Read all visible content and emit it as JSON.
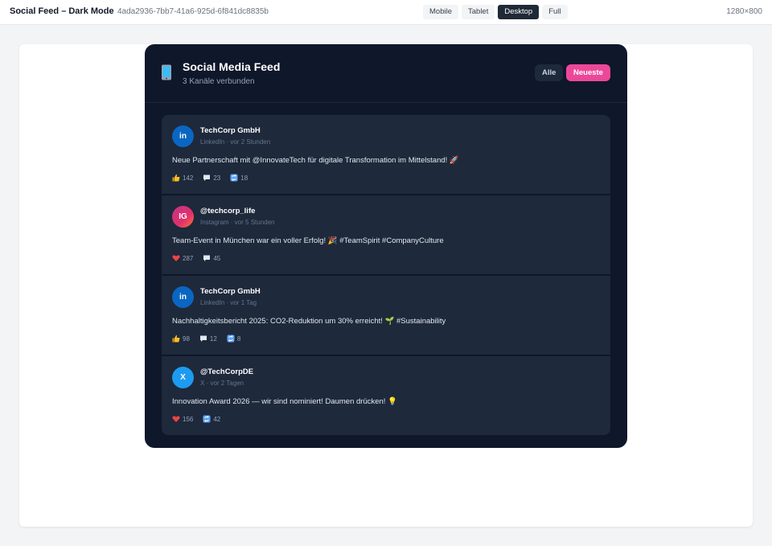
{
  "app": {
    "title": "Social Feed – Dark Mode",
    "id": "4ada2936-7bb7-41a6-925d-6f841dc8835b",
    "dimensions": "1280×800"
  },
  "viewport_tabs": [
    "Mobile",
    "Tablet",
    "Desktop",
    "Full"
  ],
  "active_viewport": "Desktop",
  "feed": {
    "title": "Social Media Feed",
    "subtitle": "3 Kanäle verbunden",
    "filters": {
      "all": "Alle",
      "newest": "Neueste"
    },
    "posts": [
      {
        "avatar": "in",
        "author": "TechCorp GmbH",
        "meta": "LinkedIn · vor 2 Stunden",
        "text": "Neue Partnerschaft mit @InnovateTech für digitale Transformation im Mittelstand! 🚀",
        "stats": [
          {
            "icon": "thumbs-up-icon",
            "value": "142"
          },
          {
            "icon": "comment-icon",
            "value": "23"
          },
          {
            "icon": "repost-icon",
            "value": "18"
          }
        ]
      },
      {
        "avatar": "IG",
        "author": "@techcorp_life",
        "meta": "Instagram · vor 5 Stunden",
        "text": "Team-Event in München war ein voller Erfolg! 🎉 #TeamSpirit #CompanyCulture",
        "stats": [
          {
            "icon": "heart-icon",
            "value": "287"
          },
          {
            "icon": "comment-icon",
            "value": "45"
          }
        ]
      },
      {
        "avatar": "in",
        "author": "TechCorp GmbH",
        "meta": "LinkedIn · vor 1 Tag",
        "text": "Nachhaltigkeitsbericht 2025: CO2-Reduktion um 30% erreicht! 🌱 #Sustainability",
        "stats": [
          {
            "icon": "thumbs-up-icon",
            "value": "98"
          },
          {
            "icon": "comment-icon",
            "value": "12"
          },
          {
            "icon": "repost-icon",
            "value": "8"
          }
        ]
      },
      {
        "avatar": "X",
        "author": "@TechCorpDE",
        "meta": "X · vor 2 Tagen",
        "text": "Innovation Award 2026 — wir sind nominiert! Daumen drücken! 💡",
        "stats": [
          {
            "icon": "heart-icon",
            "value": "156"
          },
          {
            "icon": "repost-icon",
            "value": "42"
          }
        ]
      }
    ]
  },
  "colors": {
    "feed_bg": "#0f172a",
    "card_bg": "#1e293b",
    "accent": "#ec4899",
    "linkedin": "#0a66c2",
    "x": "#1d9bf0"
  }
}
